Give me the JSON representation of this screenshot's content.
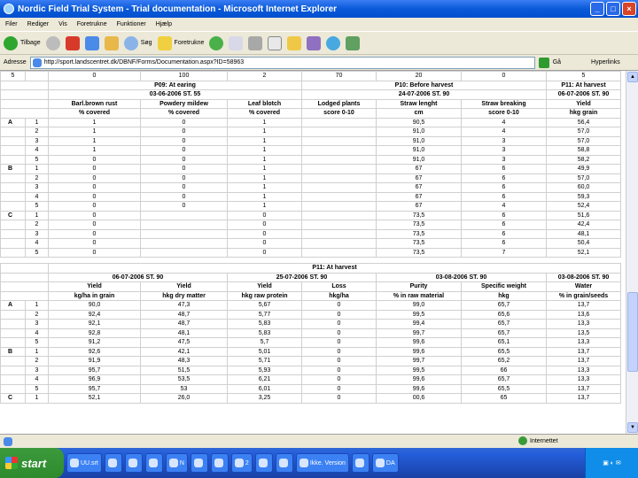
{
  "window": {
    "title": "Nordic Field Trial System - Trial documentation - Microsoft Internet Explorer"
  },
  "menu": [
    "Filer",
    "Rediger",
    "Vis",
    "Foretrukne",
    "Funktioner",
    "Hjælp"
  ],
  "toolbar": {
    "back": "Tilbage",
    "search": "Søg",
    "favorites": "Foretrukne"
  },
  "address": {
    "label": "Adresse",
    "url": "http://sport.landscentret.dk/DBNF/Forms/Documentation.aspx?ID=58963",
    "go": "Gå",
    "links": "Hyperlinks"
  },
  "table1": {
    "toprow": [
      "5",
      "0",
      "100",
      "2",
      "70",
      "20",
      "0",
      "5"
    ],
    "groups": [
      {
        "label": "P09: At earing",
        "date": "03-06-2006 ST. 55"
      },
      {
        "label": "P10: Before harvest",
        "date": "24-07-2006 ST. 90"
      },
      {
        "label": "P11: At harvest",
        "date": "06-07-2006 ST. 90"
      }
    ],
    "headers": [
      [
        "Barl.brown rust",
        "% covered"
      ],
      [
        "Powdery mildew",
        "% covered"
      ],
      [
        "Leaf blotch",
        "% covered"
      ],
      [
        "Lodged plants",
        "score 0-10"
      ],
      [
        "Straw lenght",
        "cm"
      ],
      [
        "Straw breaking",
        "score 0-10"
      ],
      [
        "Yield",
        "hkg grain"
      ]
    ],
    "rows": [
      [
        "A",
        "1",
        "1",
        "0",
        "1",
        "",
        "90,5",
        "4",
        "56,4"
      ],
      [
        "",
        "2",
        "1",
        "0",
        "1",
        "",
        "91,0",
        "4",
        "57,0"
      ],
      [
        "",
        "3",
        "1",
        "0",
        "1",
        "",
        "91,0",
        "3",
        "57,0"
      ],
      [
        "",
        "4",
        "1",
        "0",
        "1",
        "",
        "91,0",
        "3",
        "58,8"
      ],
      [
        "",
        "5",
        "0",
        "0",
        "1",
        "",
        "91,0",
        "3",
        "58,2"
      ],
      [
        "B",
        "1",
        "0",
        "0",
        "1",
        "",
        "67",
        "6",
        "49,9"
      ],
      [
        "",
        "2",
        "0",
        "0",
        "1",
        "",
        "67",
        "6",
        "57,0"
      ],
      [
        "",
        "3",
        "0",
        "0",
        "1",
        "",
        "67",
        "6",
        "60,0"
      ],
      [
        "",
        "4",
        "0",
        "0",
        "1",
        "",
        "67",
        "6",
        "59,3"
      ],
      [
        "",
        "5",
        "0",
        "0",
        "1",
        "",
        "67",
        "4",
        "52,4"
      ],
      [
        "C",
        "1",
        "0",
        "",
        "0",
        "",
        "73,5",
        "6",
        "51,6"
      ],
      [
        "",
        "2",
        "0",
        "",
        "0",
        "",
        "73,5",
        "6",
        "42,4"
      ],
      [
        "",
        "3",
        "0",
        "",
        "0",
        "",
        "73,5",
        "6",
        "48,1"
      ],
      [
        "",
        "4",
        "0",
        "",
        "0",
        "",
        "73,5",
        "6",
        "50,4"
      ],
      [
        "",
        "5",
        "0",
        "",
        "0",
        "",
        "73,5",
        "7",
        "52,1"
      ]
    ]
  },
  "table2": {
    "group": "P11: At harvest",
    "dates": [
      "06-07-2006 ST. 90",
      "25-07-2006 ST. 90",
      "03-08-2006 ST. 90",
      "03-08-2006 ST. 90"
    ],
    "headers": [
      [
        "Yield",
        "kg/ha in grain"
      ],
      [
        "Yield",
        "hkg dry matter"
      ],
      [
        "Yield",
        "hkg raw protein"
      ],
      [
        "Loss",
        "hkg/ha"
      ],
      [
        "Purity",
        "% in raw material"
      ],
      [
        "Specific weight",
        "hkg"
      ],
      [
        "Water",
        "% in grain/seeds"
      ]
    ],
    "rows": [
      [
        "A",
        "1",
        "90,0",
        "47,3",
        "5,67",
        "0",
        "99,0",
        "65,7",
        "13,7"
      ],
      [
        "",
        "2",
        "92,4",
        "48,7",
        "5,77",
        "0",
        "99,5",
        "65,6",
        "13,6"
      ],
      [
        "",
        "3",
        "92,1",
        "48,7",
        "5,83",
        "0",
        "99,4",
        "65,7",
        "13,3"
      ],
      [
        "",
        "4",
        "92,8",
        "48,1",
        "5,83",
        "0",
        "99,7",
        "65,7",
        "13,5"
      ],
      [
        "",
        "5",
        "91,2",
        "47,5",
        "5,7",
        "0",
        "99,6",
        "65,1",
        "13,3"
      ],
      [
        "B",
        "1",
        "92,6",
        "42,1",
        "5,01",
        "0",
        "99,6",
        "65,5",
        "13,7"
      ],
      [
        "",
        "2",
        "91,9",
        "48,3",
        "5,71",
        "0",
        "99,7",
        "65,2",
        "13,7"
      ],
      [
        "",
        "3",
        "95,7",
        "51,5",
        "5,93",
        "0",
        "99,5",
        "66",
        "13,3"
      ],
      [
        "",
        "4",
        "96,9",
        "53,5",
        "6,21",
        "0",
        "99,6",
        "65,7",
        "13,3"
      ],
      [
        "",
        "5",
        "95,7",
        "53",
        "6,01",
        "0",
        "99,6",
        "65,5",
        "13,7"
      ],
      [
        "C",
        "1",
        "52,1",
        "26,0",
        "3,25",
        "0",
        "00,6",
        "65",
        "13,7"
      ]
    ]
  },
  "status": {
    "zone": "Internettet"
  },
  "taskbar": {
    "start": "start",
    "tasks": [
      "UU.srt",
      "",
      "",
      "",
      "N",
      "",
      "",
      "2",
      "",
      "",
      "Ikke. Version",
      "",
      "DA"
    ]
  }
}
